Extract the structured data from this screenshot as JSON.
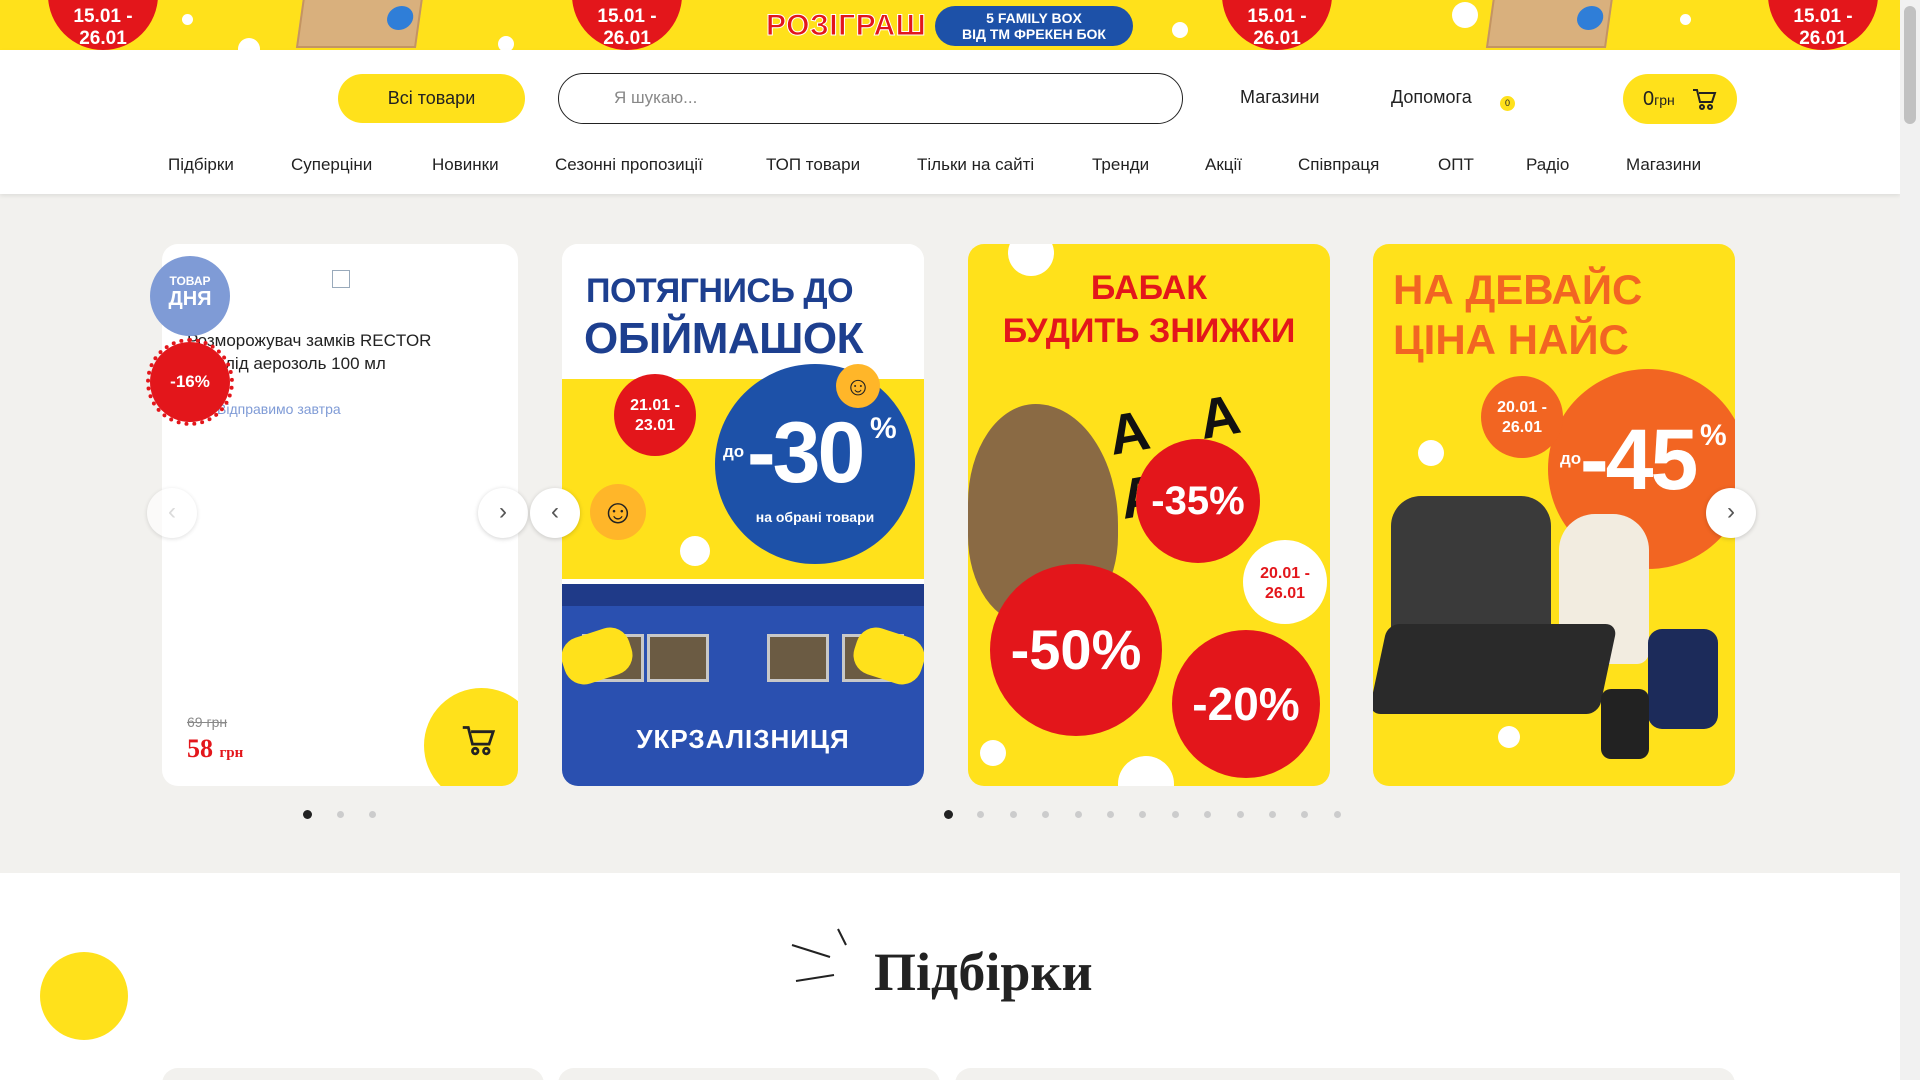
{
  "promo": {
    "dates": [
      "15.01 -\n26.01",
      "15.01 -\n26.01",
      "15.01 -\n26.01",
      "15.01 -\n26.01"
    ],
    "raffle_title": "РОЗІГРАШ",
    "raffle_pill_line1": "5 FAMILY BOX",
    "raffle_pill_line2": "ВІД ТМ ФРЕКЕН БОК"
  },
  "header": {
    "all_products": "Всі товари",
    "search_placeholder": "Я шукаю...",
    "stores": "Магазини",
    "help": "Допомога",
    "badge_count": "0",
    "cart_amount": "0",
    "cart_currency": "грн"
  },
  "nav": [
    "Підбірки",
    "Суперціни",
    "Новинки",
    "Сезонні пропозиції",
    "ТОП товари",
    "Тільки на сайті",
    "Тренди",
    "Акції",
    "Співпраця",
    "ОПТ",
    "Радіо",
    "Магазини"
  ],
  "deal": {
    "badge_line1": "ТОВАР",
    "badge_line2": "ДНЯ",
    "discount": "-16%",
    "title": "Розморожувач замків RECTOR Антилід аерозоль 100 мл",
    "shipping": "Відправимо завтра",
    "old_price": "69 грн",
    "new_price": "58",
    "new_price_unit": "грн"
  },
  "banners": [
    {
      "line1": "ПОТЯГНИСЬ ДО",
      "line2": "ОБІЙМАШОК",
      "date": "21.01 -\n23.01",
      "prefix": "до",
      "discount": "-30",
      "percent": "%",
      "note": "на обрані товари",
      "train_name": "УКРЗАЛІЗНИЦЯ"
    },
    {
      "line1": "БАБАК",
      "line2": "БУДИТЬ ЗНИЖКИ",
      "aaa": "A A A",
      "d1": "-35%",
      "d2": "-50%",
      "d3": "-20%",
      "date": "20.01 -\n26.01"
    },
    {
      "line1": "НА ДЕВАЙС",
      "line2": "ЦІНА НАЙС",
      "date": "20.01 -\n26.01",
      "prefix": "до",
      "discount": "-45",
      "percent": "%"
    }
  ],
  "pagination": {
    "left_dots": 3,
    "left_active": 0,
    "right_dots": 13,
    "right_active": 0
  },
  "section": {
    "title": "Підбірки"
  },
  "colors": {
    "brand_yellow": "#ffe11b",
    "accent_red": "#e3161b",
    "accent_blue": "#1d51a8",
    "accent_orange": "#f26522"
  }
}
